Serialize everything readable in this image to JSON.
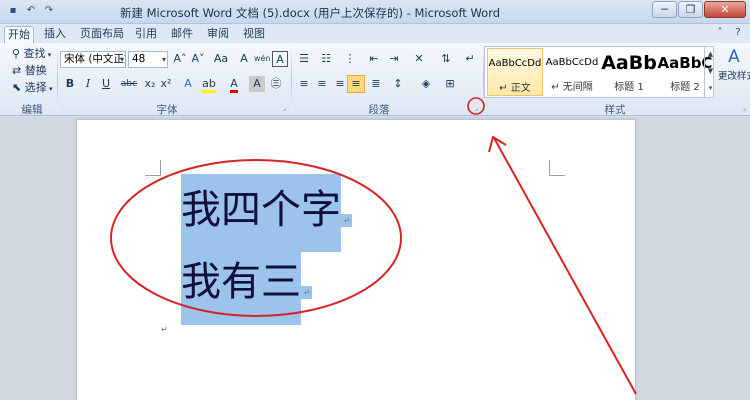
{
  "window": {
    "title": "新建 Microsoft Word 文档 (5).docx (用户上次保存的) - Microsoft Word",
    "minimize": "─",
    "maximize": "❐",
    "close": "✕"
  },
  "qat": {
    "save": "▪",
    "undo": "↶",
    "redo": "↷"
  },
  "tabs": [
    "开始",
    "插入",
    "页面布局",
    "引用",
    "邮件",
    "审阅",
    "视图"
  ],
  "ribbon": {
    "editing": {
      "find": "查找",
      "replace": "替换",
      "select": "选择",
      "label": "编辑"
    },
    "font": {
      "font_name": "宋体 (中文正文",
      "font_size": "48",
      "grow": "A˄",
      "shrink": "A˅",
      "change_case": "Aa",
      "clear": "A",
      "pinyin": "wén",
      "bold": "B",
      "italic": "I",
      "underline": "U",
      "strike": "abc",
      "subscript": "x₂",
      "superscript": "x²",
      "char_shading": "A",
      "label": "字体"
    },
    "paragraph": {
      "label": "段落"
    },
    "styles": {
      "items": [
        {
          "preview": "AaBbCcDd",
          "name": "↵ 正文"
        },
        {
          "preview": "AaBbCcDd",
          "name": "↵ 无间隔"
        },
        {
          "preview": "AaBb",
          "name": "标题 1"
        },
        {
          "preview": "AaBbC",
          "name": "标题 2"
        }
      ],
      "change": "更改样式",
      "label": "样式"
    }
  },
  "document": {
    "line1": "我四个字",
    "line2": "我有三",
    "para_mark": "↵"
  },
  "colors": {
    "annotation": "#d62424",
    "selection": "#9cc3eb",
    "styles_selected": "#ffe9a8"
  }
}
